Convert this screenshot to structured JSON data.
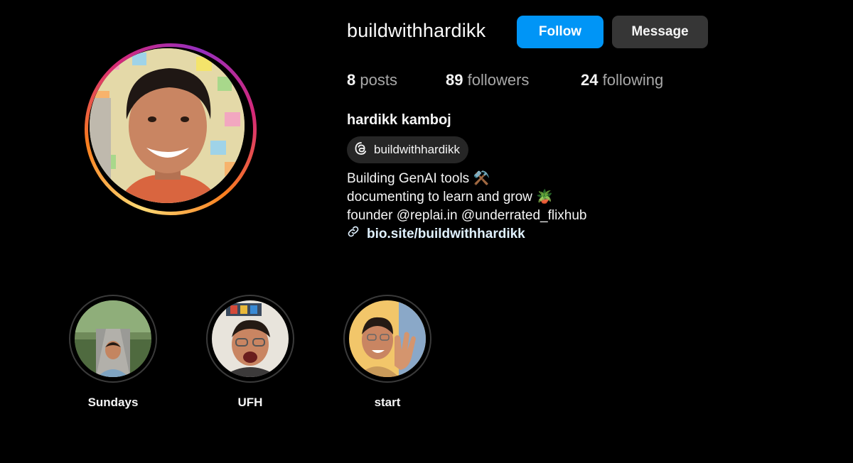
{
  "profile": {
    "username": "buildwithhardikk",
    "full_name": "hardikk kamboj",
    "avatar_icon": "profile-photo"
  },
  "actions": {
    "follow_label": "Follow",
    "message_label": "Message",
    "follow_color": "#0095f6",
    "message_color": "#363636"
  },
  "stats": {
    "posts_count": "8",
    "posts_label": "posts",
    "followers_count": "89",
    "followers_label": "followers",
    "following_count": "24",
    "following_label": "following"
  },
  "threads": {
    "handle": "buildwithhardikk",
    "icon": "threads-icon"
  },
  "bio": {
    "lines": [
      "Building GenAI tools ⚒️",
      "documenting to learn and grow 🪴",
      "founder @replai.in @underrated_flixhub"
    ],
    "link_text": "bio.site/buildwithhardikk",
    "link_icon": "link-icon"
  },
  "highlights": [
    {
      "label": "Sundays"
    },
    {
      "label": "UFH"
    },
    {
      "label": "start"
    }
  ],
  "colors": {
    "background": "#000000",
    "ring_gradient": [
      "#feda75",
      "#fa7e1e",
      "#d62976",
      "#962fbf"
    ]
  }
}
